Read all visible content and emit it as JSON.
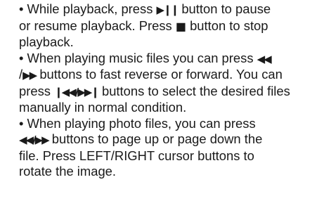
{
  "paragraphs": [
    {
      "lines": [
        [
          "• While playback, press ",
          {
            "sym": "▶❙❙"
          },
          " button to pause"
        ],
        [
          "or resume playback. Press ",
          {
            "sym": "■"
          },
          " button to stop"
        ],
        [
          "playback."
        ]
      ]
    },
    {
      "lines": [
        [
          "• When playing music files you can press ",
          {
            "sym": "◀◀"
          }
        ],
        [
          "/",
          {
            "sym": "▶▶"
          },
          " buttons to fast reverse or forward. You can"
        ],
        [
          "press ",
          {
            "sym": "❙◀◀/▶▶❙"
          },
          " buttons to select the desired files"
        ],
        [
          "manually in normal condition."
        ]
      ]
    },
    {
      "lines": [
        [
          "• When playing photo files, you can press"
        ],
        [
          {
            "sym": "◀◀/▶▶"
          },
          " buttons to page up or page down the"
        ],
        [
          "file. Press LEFT/RIGHT cursor buttons to"
        ],
        [
          "rotate the image."
        ]
      ]
    }
  ]
}
